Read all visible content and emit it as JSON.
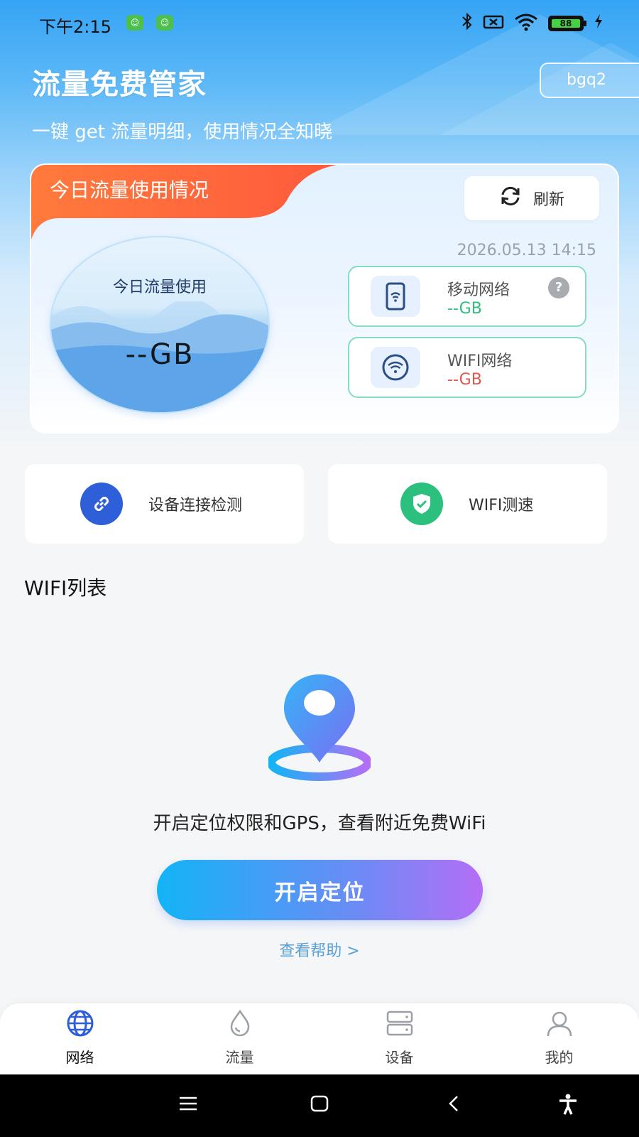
{
  "status_bar": {
    "time": "下午2:15",
    "battery": "88"
  },
  "header": {
    "title": "流量免费管家",
    "user": "bgq2",
    "subtitle": "一键 get 流量明细，使用情况全知晓"
  },
  "usage_card": {
    "tag": "今日流量使用情况",
    "refresh_label": "刷新",
    "timestamp": "2026.05.13 14:15",
    "gauge_label": "今日流量使用",
    "gauge_value": "--GB",
    "mobile": {
      "name": "移动网络",
      "value": "--GB",
      "color": "#2cc07e"
    },
    "wifi": {
      "name": "WIFI网络",
      "value": "--GB",
      "color": "#e0574b"
    }
  },
  "features": {
    "device_check": "设备连接检测",
    "wifi_speed": "WIFI测速"
  },
  "wifi_list": {
    "title": "WIFI列表",
    "gps_prompt": "开启定位权限和GPS，查看附近免费WiFi",
    "locate_button": "开启定位",
    "help_link": "查看帮助 >"
  },
  "bottom_nav": {
    "items": [
      {
        "label": "网络",
        "icon": "globe-icon",
        "active": true
      },
      {
        "label": "流量",
        "icon": "drop-icon",
        "active": false
      },
      {
        "label": "设备",
        "icon": "server-icon",
        "active": false
      },
      {
        "label": "我的",
        "icon": "user-icon",
        "active": false
      }
    ]
  },
  "colors": {
    "accent_blue": "#2f5fd8",
    "tag_orange": "#ff6a3d",
    "shield_green": "#2cc07e"
  }
}
